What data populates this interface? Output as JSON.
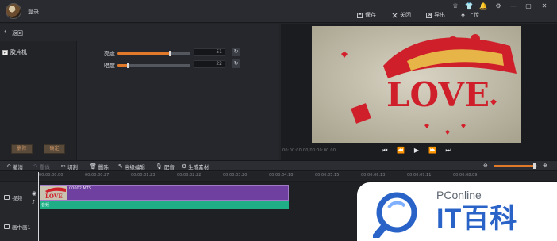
{
  "topbar": {
    "login": "登录",
    "save": "保存",
    "close": "关闭",
    "export": "导出",
    "upload": "上传"
  },
  "left_panel": {
    "back": "返回",
    "filter_item": "胶片机",
    "brightness_label": "亮度",
    "brightness_value": "51",
    "brightness_level": 0.72,
    "darkness_label": "暗度",
    "darkness_value": "22",
    "darkness_level": 0.14,
    "delete_btn": "删除",
    "confirm_btn": "确定"
  },
  "preview": {
    "timecode": "00:00:00.00/00:00:00.00",
    "love_text": "LOVE"
  },
  "toolbar": {
    "undo": "撤消",
    "redo": "重做",
    "cut": "切割",
    "delete": "删除",
    "advanced_edit": "高级编辑",
    "dubbing": "配音",
    "generate": "生成素材",
    "zoom_level": 0.93
  },
  "timeline": {
    "ticks": [
      "00:00:00.00",
      "00:00:00.27",
      "00:00:01.23",
      "00:00:02.22",
      "00:00:03.20",
      "00:00:04.18",
      "00:00:05.15",
      "00:00:06.13",
      "00:00:07.11",
      "00:00:08.09"
    ],
    "track_video": "视频",
    "track_pip": "画中画1",
    "clip_name": "00002.MTS",
    "audio_label": "音频"
  },
  "watermark": {
    "pc": "PConline",
    "brand": "IT百科"
  },
  "colors": {
    "accent": "#e07a2a",
    "clip_video": "#7040a0",
    "clip_audio": "#1fae86",
    "brand": "#2a63c8"
  }
}
